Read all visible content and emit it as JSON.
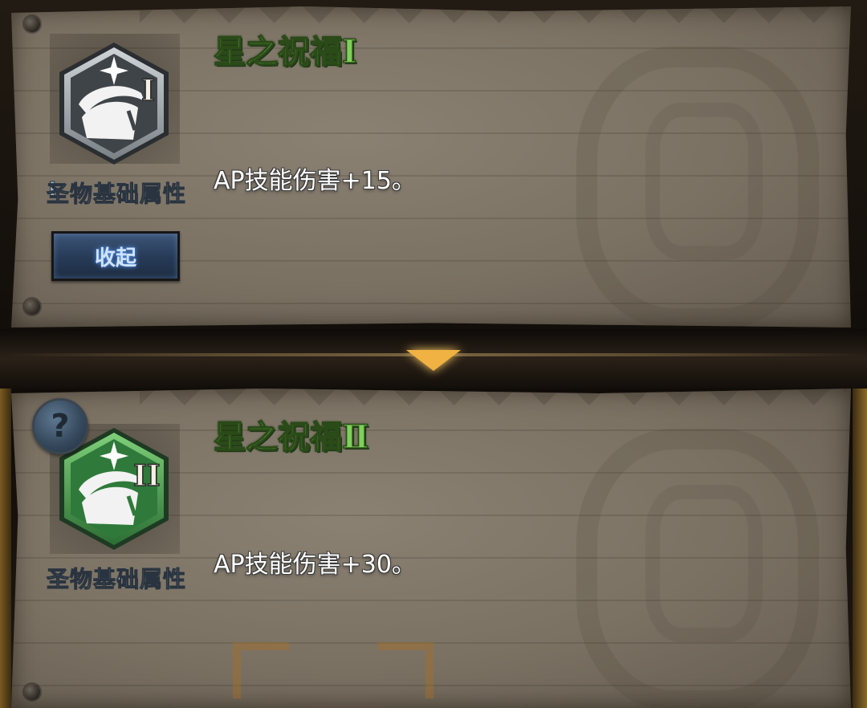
{
  "cards": [
    {
      "title": "星之祝福Ⅰ",
      "tier": "I",
      "category": "圣物基础属性",
      "description": "AP技能伤害+15。",
      "icon": "star-blessing-emblem-silver",
      "icon_color": "#b8bec4",
      "collapse_label": "收起"
    },
    {
      "title": "星之祝福Ⅱ",
      "tier": "II",
      "category": "圣物基础属性",
      "description": "AP技能伤害+30。",
      "icon": "star-blessing-emblem-green",
      "icon_color": "#3f9a4e",
      "help_label": "?"
    }
  ],
  "colors": {
    "title_green": "#7fd05a",
    "label_blue": "#9ab0c8",
    "arrow_gold": "#f0b242",
    "button_blue": "#263a56"
  }
}
